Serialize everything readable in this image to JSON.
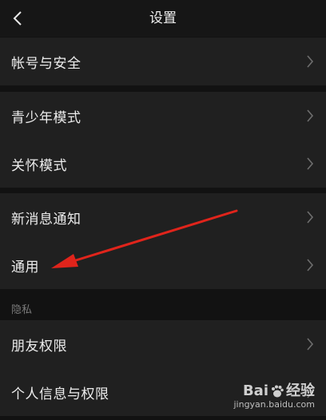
{
  "header": {
    "title": "设置",
    "back_icon": "chevron-left-icon"
  },
  "groups": [
    {
      "items": [
        {
          "label": "帐号与安全"
        }
      ]
    },
    {
      "items": [
        {
          "label": "青少年模式"
        },
        {
          "label": "关怀模式"
        }
      ]
    },
    {
      "items": [
        {
          "label": "新消息通知"
        },
        {
          "label": "通用"
        }
      ]
    }
  ],
  "privacy": {
    "section_label": "隐私",
    "items": [
      {
        "label": "朋友权限"
      },
      {
        "label": "个人信息与权限"
      }
    ]
  },
  "annotation": {
    "color": "#e0241b",
    "points_to": "通用"
  },
  "watermark": {
    "logo_text_1": "Bai",
    "logo_text_2": "经验",
    "url": "jingyan.baidu.com"
  },
  "colors": {
    "background": "#121212",
    "row_background": "#202020",
    "chevron": "#6e6e6e"
  }
}
